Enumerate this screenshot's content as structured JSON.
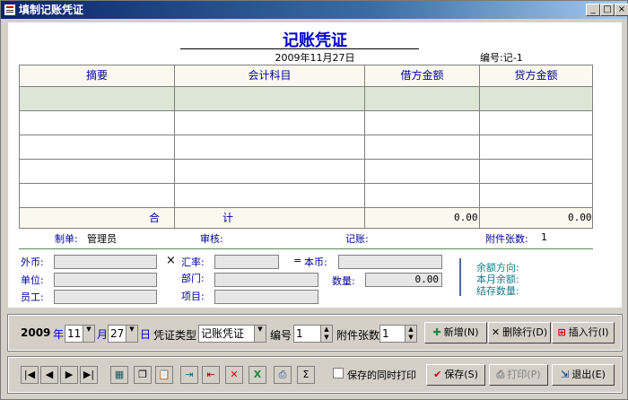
{
  "window": {
    "title": "填制记账凭证",
    "min": "_",
    "max": "□",
    "close": "×"
  },
  "voucher": {
    "title": "记账凭证",
    "date": "2009年11月27日",
    "no_label": "编号:",
    "no_value": "记-1",
    "columns": [
      "摘要",
      "会计科目",
      "借方金额",
      "贷方金额"
    ],
    "sum_label_a": "合",
    "sum_label_b": "计",
    "sum_debit": "0.00",
    "sum_credit": "0.00"
  },
  "sign": {
    "maker_label": "制单:",
    "maker": "管理员",
    "audit_label": "审核:",
    "post_label": "记账:",
    "attach_label": "附件张数:",
    "attach_value": "1"
  },
  "fields": {
    "foreign": "外币:",
    "rate": "汇率:",
    "base": "本币:",
    "unit": "单位:",
    "dept": "部门:",
    "qty": "数量:",
    "qty_value": "0.00",
    "staff": "员工:",
    "project": "项目:",
    "x_mark": "×",
    "eq_mark": "="
  },
  "balance": {
    "dir": "余额方向:",
    "month": "本月余额:",
    "stock": "结存数量:"
  },
  "controls": {
    "year": "2009",
    "year_lbl": "年",
    "month": "11",
    "month_lbl": "月",
    "day": "27",
    "day_lbl": "日",
    "type_label": "凭证类型",
    "type_value": "记账凭证",
    "no_label": "编号",
    "no_value": "1",
    "attach_label": "附件张数",
    "attach_value": "1",
    "add": "新增(N)",
    "del_row": "删除行(D)",
    "ins_row": "插入行(I)",
    "save": "保存(S)",
    "print": "打印(P)",
    "exit": "退出(E)",
    "print_check": "保存的同时打印"
  },
  "colors": {
    "accent": "#0000c8",
    "title_bar": "#0a246a"
  },
  "toolbar_icons": [
    "first-icon",
    "prev-icon",
    "next-icon",
    "last-icon",
    "calculator-icon",
    "copy-icon",
    "paste-icon",
    "import-icon",
    "export-icon",
    "delete-icon",
    "excel-icon",
    "print-preview-icon",
    "sum-icon"
  ]
}
